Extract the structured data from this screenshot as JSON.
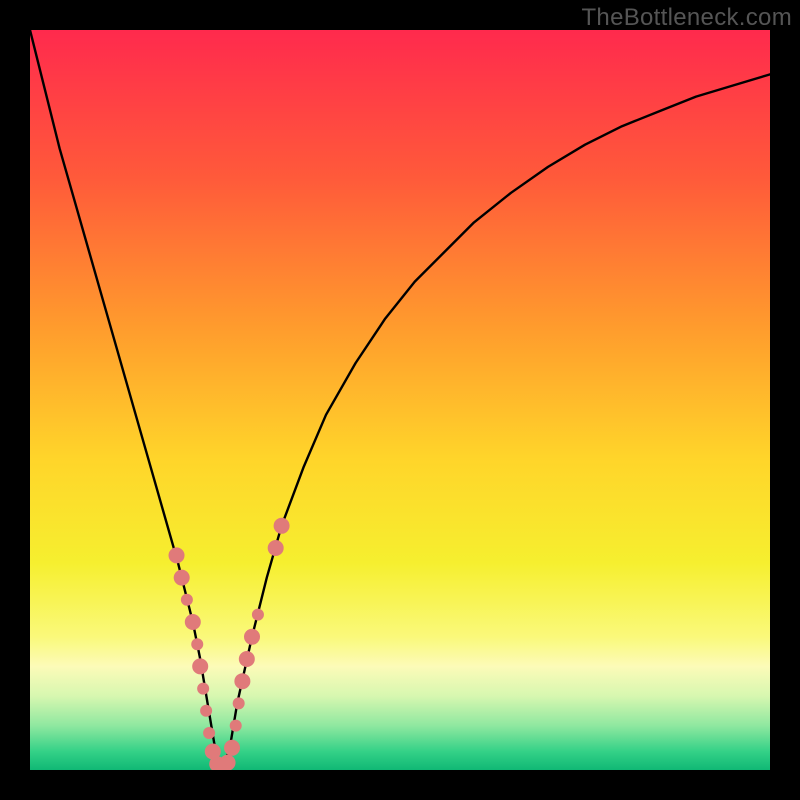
{
  "watermark": "TheBottleneck.com",
  "chart_data": {
    "type": "line",
    "title": "",
    "xlabel": "",
    "ylabel": "",
    "xlim": [
      0,
      100
    ],
    "ylim": [
      0,
      100
    ],
    "x": [
      0,
      2,
      4,
      6,
      8,
      10,
      12,
      14,
      16,
      18,
      20,
      22,
      23,
      24,
      25,
      26,
      27,
      28,
      30,
      32,
      34,
      37,
      40,
      44,
      48,
      52,
      56,
      60,
      65,
      70,
      75,
      80,
      85,
      90,
      95,
      100
    ],
    "y": [
      100,
      92,
      84,
      77,
      70,
      63,
      56,
      49,
      42,
      35,
      28,
      20,
      15,
      9,
      3,
      0,
      3,
      9,
      18,
      26,
      33,
      41,
      48,
      55,
      61,
      66,
      70,
      74,
      78,
      81.5,
      84.5,
      87,
      89,
      91,
      92.5,
      94
    ],
    "background_gradient": {
      "stops": [
        {
          "offset": 0.0,
          "color": "#ff2a4d"
        },
        {
          "offset": 0.2,
          "color": "#ff5a3a"
        },
        {
          "offset": 0.4,
          "color": "#ff9b2d"
        },
        {
          "offset": 0.58,
          "color": "#ffd52a"
        },
        {
          "offset": 0.72,
          "color": "#f6ef2f"
        },
        {
          "offset": 0.82,
          "color": "#faf97a"
        },
        {
          "offset": 0.86,
          "color": "#fcfbb8"
        },
        {
          "offset": 0.9,
          "color": "#d7f7b0"
        },
        {
          "offset": 0.94,
          "color": "#8fe8a0"
        },
        {
          "offset": 0.975,
          "color": "#34d187"
        },
        {
          "offset": 1.0,
          "color": "#10b875"
        }
      ]
    },
    "markers": {
      "color": "#e07a7a",
      "radius_small": 6,
      "radius_large": 8,
      "points": [
        {
          "x": 19.8,
          "y": 29,
          "r": "large"
        },
        {
          "x": 20.5,
          "y": 26,
          "r": "large"
        },
        {
          "x": 21.2,
          "y": 23,
          "r": "small"
        },
        {
          "x": 22.0,
          "y": 20,
          "r": "large"
        },
        {
          "x": 22.6,
          "y": 17,
          "r": "small"
        },
        {
          "x": 23.0,
          "y": 14,
          "r": "large"
        },
        {
          "x": 23.4,
          "y": 11,
          "r": "small"
        },
        {
          "x": 23.8,
          "y": 8,
          "r": "small"
        },
        {
          "x": 24.2,
          "y": 5,
          "r": "small"
        },
        {
          "x": 24.7,
          "y": 2.5,
          "r": "large"
        },
        {
          "x": 25.3,
          "y": 0.8,
          "r": "large"
        },
        {
          "x": 26.0,
          "y": 0.3,
          "r": "large"
        },
        {
          "x": 26.7,
          "y": 1.0,
          "r": "large"
        },
        {
          "x": 27.3,
          "y": 3.0,
          "r": "large"
        },
        {
          "x": 27.8,
          "y": 6,
          "r": "small"
        },
        {
          "x": 28.2,
          "y": 9,
          "r": "small"
        },
        {
          "x": 28.7,
          "y": 12,
          "r": "large"
        },
        {
          "x": 29.3,
          "y": 15,
          "r": "large"
        },
        {
          "x": 30.0,
          "y": 18,
          "r": "large"
        },
        {
          "x": 30.8,
          "y": 21,
          "r": "small"
        },
        {
          "x": 33.2,
          "y": 30,
          "r": "large"
        },
        {
          "x": 34.0,
          "y": 33,
          "r": "large"
        }
      ]
    }
  }
}
